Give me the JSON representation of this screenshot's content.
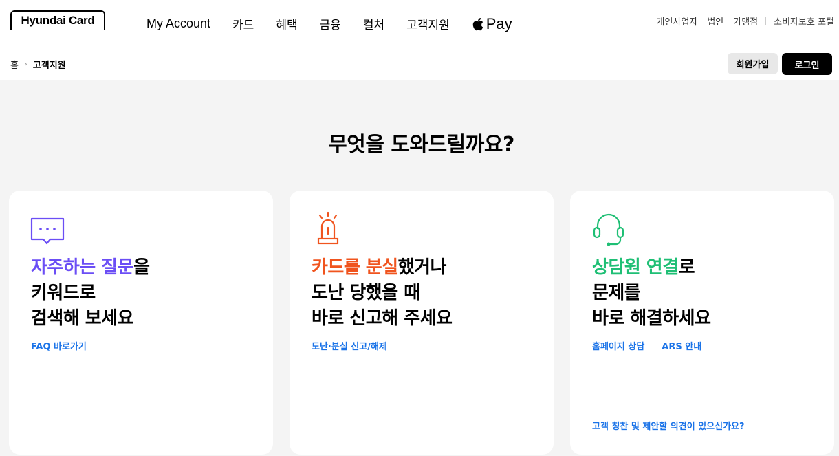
{
  "header": {
    "logo_text": "Hyundai Card",
    "menu": [
      {
        "label": "My Account"
      },
      {
        "label": "카드"
      },
      {
        "label": "혜택"
      },
      {
        "label": "금융"
      },
      {
        "label": "컬처"
      },
      {
        "label": "고객지원"
      }
    ],
    "pay_label": "Pay",
    "util": [
      "개인사업자",
      "법인",
      "가맹점",
      "소비자보호 포털"
    ]
  },
  "subbar": {
    "breadcrumb": [
      "홈",
      "고객지원"
    ],
    "join_label": "회원가입",
    "login_label": "로그인"
  },
  "main": {
    "headline": "무엇을 도와드릴까요?",
    "cards": [
      {
        "icon": "chat-bubble-icon",
        "accent": "#6b4ef5",
        "title_highlight": "자주하는 질문",
        "title_rest": "을",
        "title_line2": "키워드로",
        "title_line3": "검색해 보세요",
        "links": [
          "FAQ 바로가기"
        ],
        "bottom_link": ""
      },
      {
        "icon": "siren-icon",
        "accent": "#f0541e",
        "title_highlight": "카드를 분실",
        "title_rest": "했거나",
        "title_line2": "도난 당했을 때",
        "title_line3": "바로 신고해 주세요",
        "links": [
          "도난·분실 신고/해제"
        ],
        "bottom_link": ""
      },
      {
        "icon": "headset-icon",
        "accent": "#1fbf75",
        "title_highlight": "상담원 연결",
        "title_rest": "로",
        "title_line2": "문제를",
        "title_line3": "바로 해결하세요",
        "links": [
          "홈페이지 상담",
          "ARS 안내"
        ],
        "bottom_link": "고객 칭찬 및 제안할 의견이 있으신가요?"
      }
    ]
  }
}
